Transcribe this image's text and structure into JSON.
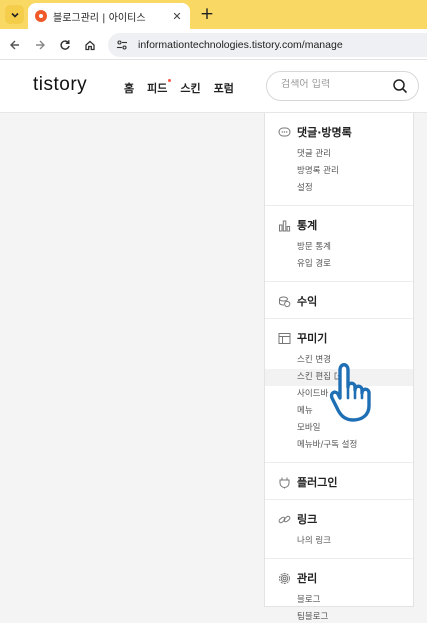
{
  "browser": {
    "tab_title": "블로그관리 | 아이티스",
    "new_tab_label": "+",
    "close_label": "✕",
    "url": "informationtechnologies.tistory.com/manage"
  },
  "header": {
    "logo": "tistory",
    "nav": [
      {
        "label": "홈"
      },
      {
        "label": "피드",
        "has_dot": true
      },
      {
        "label": "스킨"
      },
      {
        "label": "포럼"
      }
    ],
    "search_placeholder": "검색어 입력"
  },
  "menu": {
    "comments": {
      "title": "댓글·방명록",
      "items": [
        "댓글 관리",
        "방명록 관리",
        "설정"
      ]
    },
    "stats": {
      "title": "통계",
      "items": [
        "방문 통계",
        "유입 경로"
      ]
    },
    "revenue": {
      "title": "수익"
    },
    "decorate": {
      "title": "꾸미기",
      "items": [
        "스킨 변경",
        "스킨 편집",
        "사이드바",
        "메뉴",
        "모바일",
        "메뉴바/구독 설정"
      ]
    },
    "plugin": {
      "title": "플러그인"
    },
    "link": {
      "title": "링크",
      "items": [
        "나의 링크"
      ]
    },
    "manage": {
      "title": "관리",
      "items": [
        "블로그",
        "팀블로그"
      ]
    }
  },
  "colors": {
    "tabstrip": "#f9d864",
    "favicon": "#f05a28",
    "cursor_outline": "#1f6fb5"
  }
}
